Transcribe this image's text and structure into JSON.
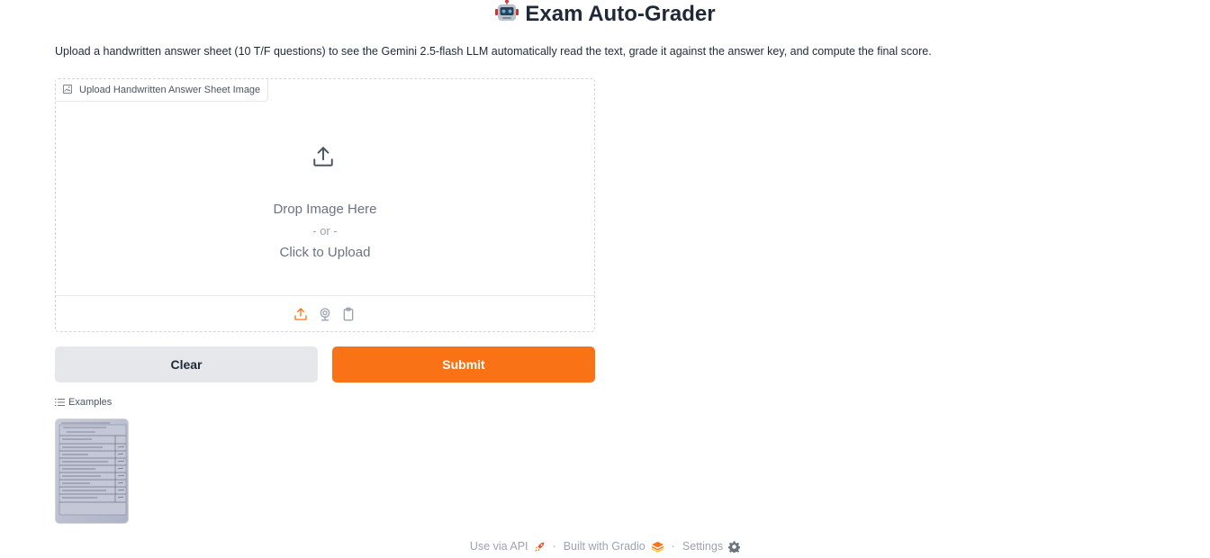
{
  "header": {
    "title": "Exam Auto-Grader",
    "description": "Upload a handwritten answer sheet (10 T/F questions) to see the Gemini 2.5-flash LLM automatically read the text, grade it against the answer key, and compute the final score."
  },
  "upload": {
    "label": "Upload Handwritten Answer Sheet Image",
    "drop_text": "Drop Image Here",
    "or_text": "- or -",
    "click_text": "Click to Upload",
    "sources": [
      "upload-icon",
      "webcam-icon",
      "clipboard-icon"
    ]
  },
  "buttons": {
    "clear_label": "Clear",
    "submit_label": "Submit"
  },
  "examples": {
    "label": "Examples"
  },
  "footer": {
    "api_label": "Use via API",
    "built_label": "Built with Gradio",
    "settings_label": "Settings",
    "separator": "·"
  },
  "colors": {
    "accent": "#f97316",
    "secondary_button": "#e5e7eb"
  }
}
